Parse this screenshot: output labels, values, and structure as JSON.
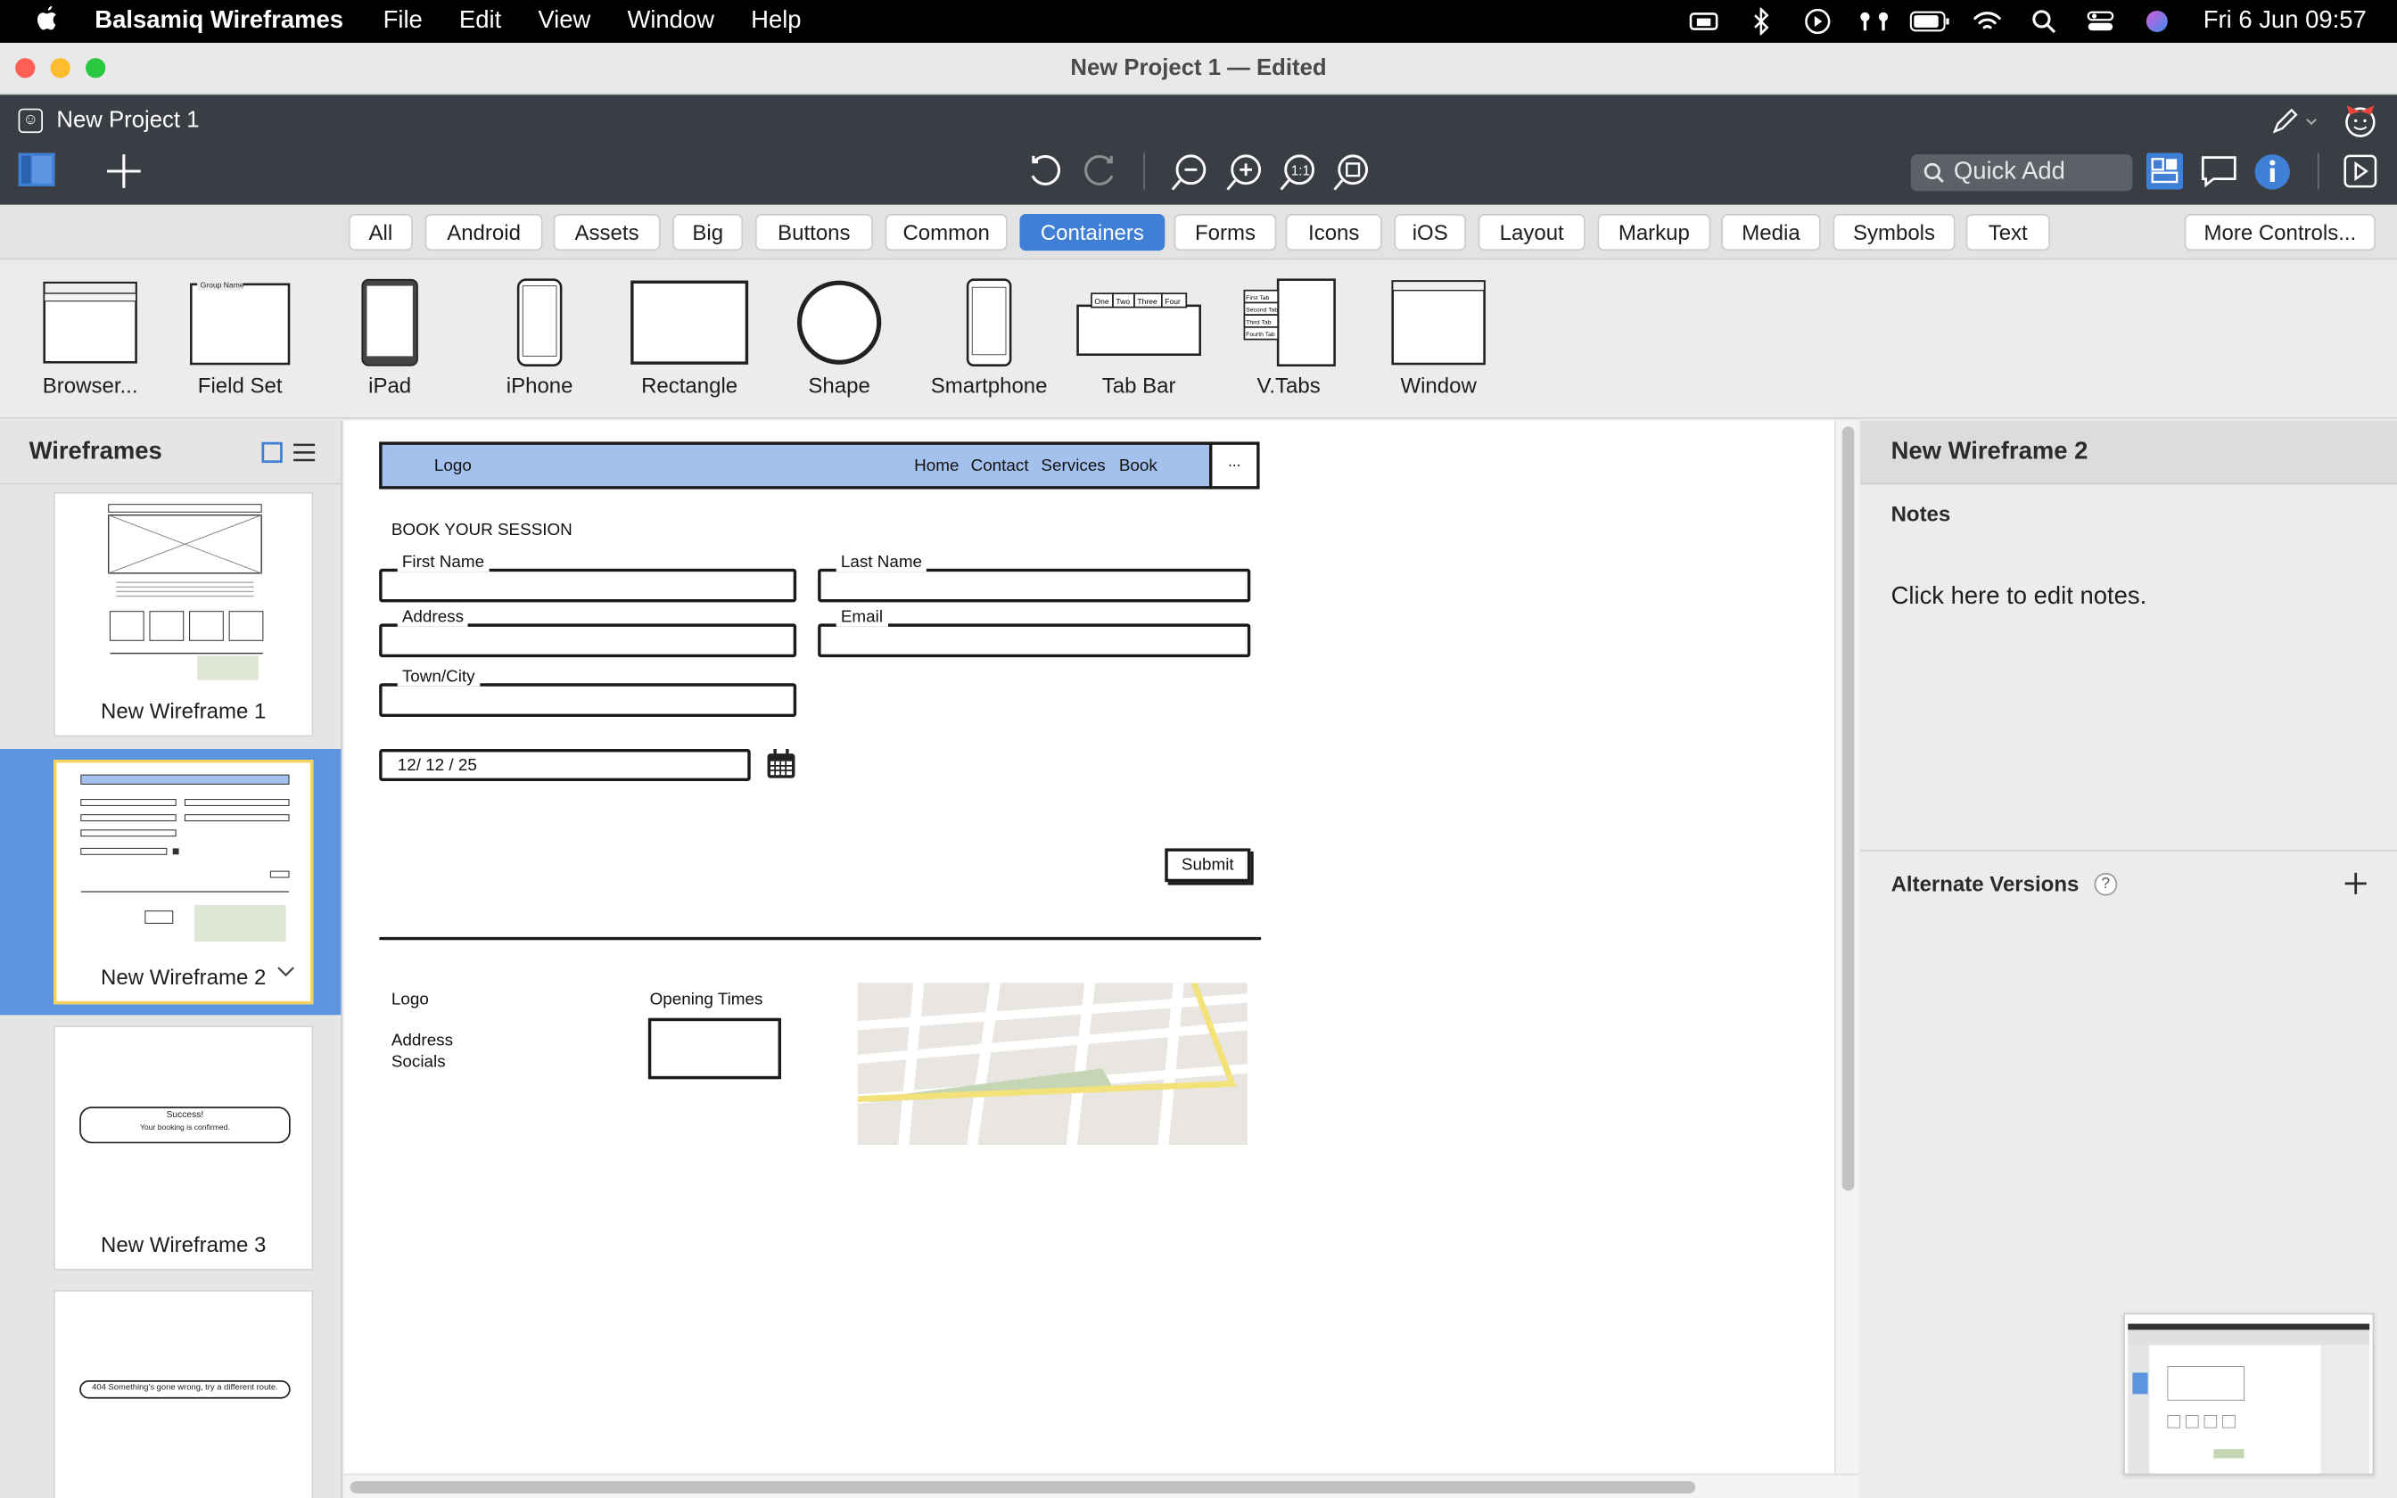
{
  "menubar": {
    "app_name": "Balsamiq Wireframes",
    "menus": [
      "File",
      "Edit",
      "View",
      "Window",
      "Help"
    ],
    "clock": "Fri 6 Jun  09:57"
  },
  "window": {
    "title": "New Project 1 — Edited",
    "project_name": "New Project 1"
  },
  "toolbar": {
    "quick_add_placeholder": "Quick Add",
    "icons": [
      "wireframes-toggle-icon",
      "add-wireframe-icon",
      "undo-icon",
      "redo-icon",
      "zoom-out-icon",
      "zoom-in-icon",
      "actual-size-icon",
      "fit-icon",
      "pencil-icon",
      "mascot-icon",
      "ui-library-icon",
      "comments-icon",
      "info-icon",
      "present-icon"
    ]
  },
  "categories": {
    "items": [
      "All",
      "Android",
      "Assets",
      "Big",
      "Buttons",
      "Common",
      "Containers",
      "Forms",
      "Icons",
      "iOS",
      "Layout",
      "Markup",
      "Media",
      "Symbols",
      "Text"
    ],
    "active": "Containers",
    "more": "More Controls..."
  },
  "library": {
    "items": [
      "Browser...",
      "Field Set",
      "iPad",
      "iPhone",
      "Rectangle",
      "Shape",
      "Smartphone",
      "Tab Bar",
      "V.Tabs",
      "Window"
    ],
    "tabbar_tabs": [
      "One",
      "Two",
      "Three",
      "Four"
    ],
    "fieldset_title": "Group Name",
    "vtabs_tabs": [
      "First Tab",
      "Second Tab",
      "Third Tab",
      "Fourth Tab"
    ]
  },
  "wireframes_panel": {
    "title": "Wireframes",
    "items": [
      {
        "name": "New Wireframe 1"
      },
      {
        "name": "New Wireframe 2",
        "selected": true
      },
      {
        "name": "New Wireframe 3",
        "success_title": "Success!",
        "success_text": "Your booking is confirmed."
      },
      {
        "name": "",
        "error_text": "404 Something's gone wrong, try a different route."
      }
    ]
  },
  "canvas": {
    "nav": {
      "logo": "Logo",
      "links": [
        "Home",
        "Contact",
        "Services",
        "Book"
      ],
      "menu": "..."
    },
    "form": {
      "heading": "BOOK YOUR SESSION",
      "fields": {
        "first_name": "First Name",
        "last_name": "Last Name",
        "address": "Address",
        "email": "Email",
        "town": "Town/City"
      },
      "date_value": "12/ 12 / 25",
      "submit": "Submit"
    },
    "footer": {
      "logo": "Logo",
      "address": "Address",
      "socials": "Socials",
      "opening_times": "Opening Times"
    }
  },
  "right_panel": {
    "title": "New Wireframe 2",
    "notes_label": "Notes",
    "notes_placeholder": "Click here to edit notes.",
    "alternate_versions": "Alternate Versions",
    "help": "?"
  },
  "colors": {
    "accent": "#3f7fd6",
    "selection": "#5b95dd",
    "nav_fill": "#a4c1ee",
    "toolbar_dark": "#3a3e44"
  }
}
